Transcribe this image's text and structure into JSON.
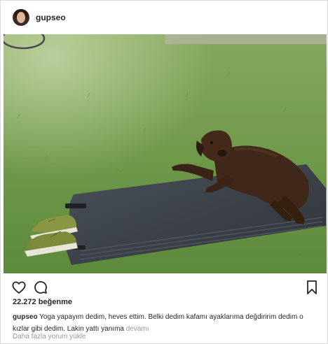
{
  "post": {
    "username": "gupseo",
    "likes": "22.272 beğenme",
    "caption_user": "gupseo",
    "caption_text": "Yoga yapayım dedim, heves ettim. Belki dedim kafamı ayaklarıma değdiririm dedim o kızlar gibi dedim. Lakin yattı yanıma",
    "more_label": "devamı",
    "load_comments": "Daha fazla yorum yükle"
  },
  "icons": {
    "like": "heart-icon",
    "comment": "comment-icon",
    "save": "bookmark-icon"
  },
  "colors": {
    "grass": "#6f9a4a",
    "mat": "#3a3f45",
    "dog": "#3a2418",
    "shoes": "#7d8a3a",
    "muted_text": "#999999"
  }
}
